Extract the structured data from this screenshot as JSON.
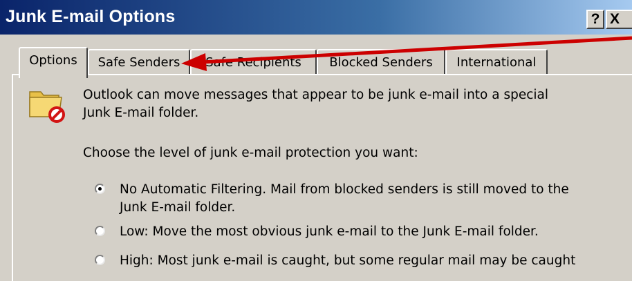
{
  "window": {
    "title": "Junk E-mail Options",
    "help_label": "?",
    "close_label": "X"
  },
  "tabs": [
    {
      "label": "Options",
      "active": true
    },
    {
      "label": "Safe Senders",
      "active": false
    },
    {
      "label": "Safe Recipients",
      "active": false
    },
    {
      "label": "Blocked Senders",
      "active": false
    },
    {
      "label": "International",
      "active": false
    }
  ],
  "options_panel": {
    "icon": "junk-folder-icon",
    "intro_line1": "Outlook can move messages that appear to be junk e-mail into a special",
    "intro_line2": "Junk E-mail folder.",
    "prompt": "Choose the level of junk e-mail protection you want:",
    "levels": [
      {
        "line1": "No Automatic Filtering. Mail from blocked senders is still moved to the",
        "line2": "Junk E-mail folder.",
        "selected": true
      },
      {
        "line1": "Low: Move the most obvious junk e-mail to the Junk E-mail folder.",
        "selected": false
      },
      {
        "line1": "High: Most junk e-mail is caught, but some regular mail may be caught",
        "selected": false
      }
    ]
  },
  "annotation": {
    "type": "arrow",
    "color": "#cc0000",
    "points_to": "Safe Senders tab"
  }
}
